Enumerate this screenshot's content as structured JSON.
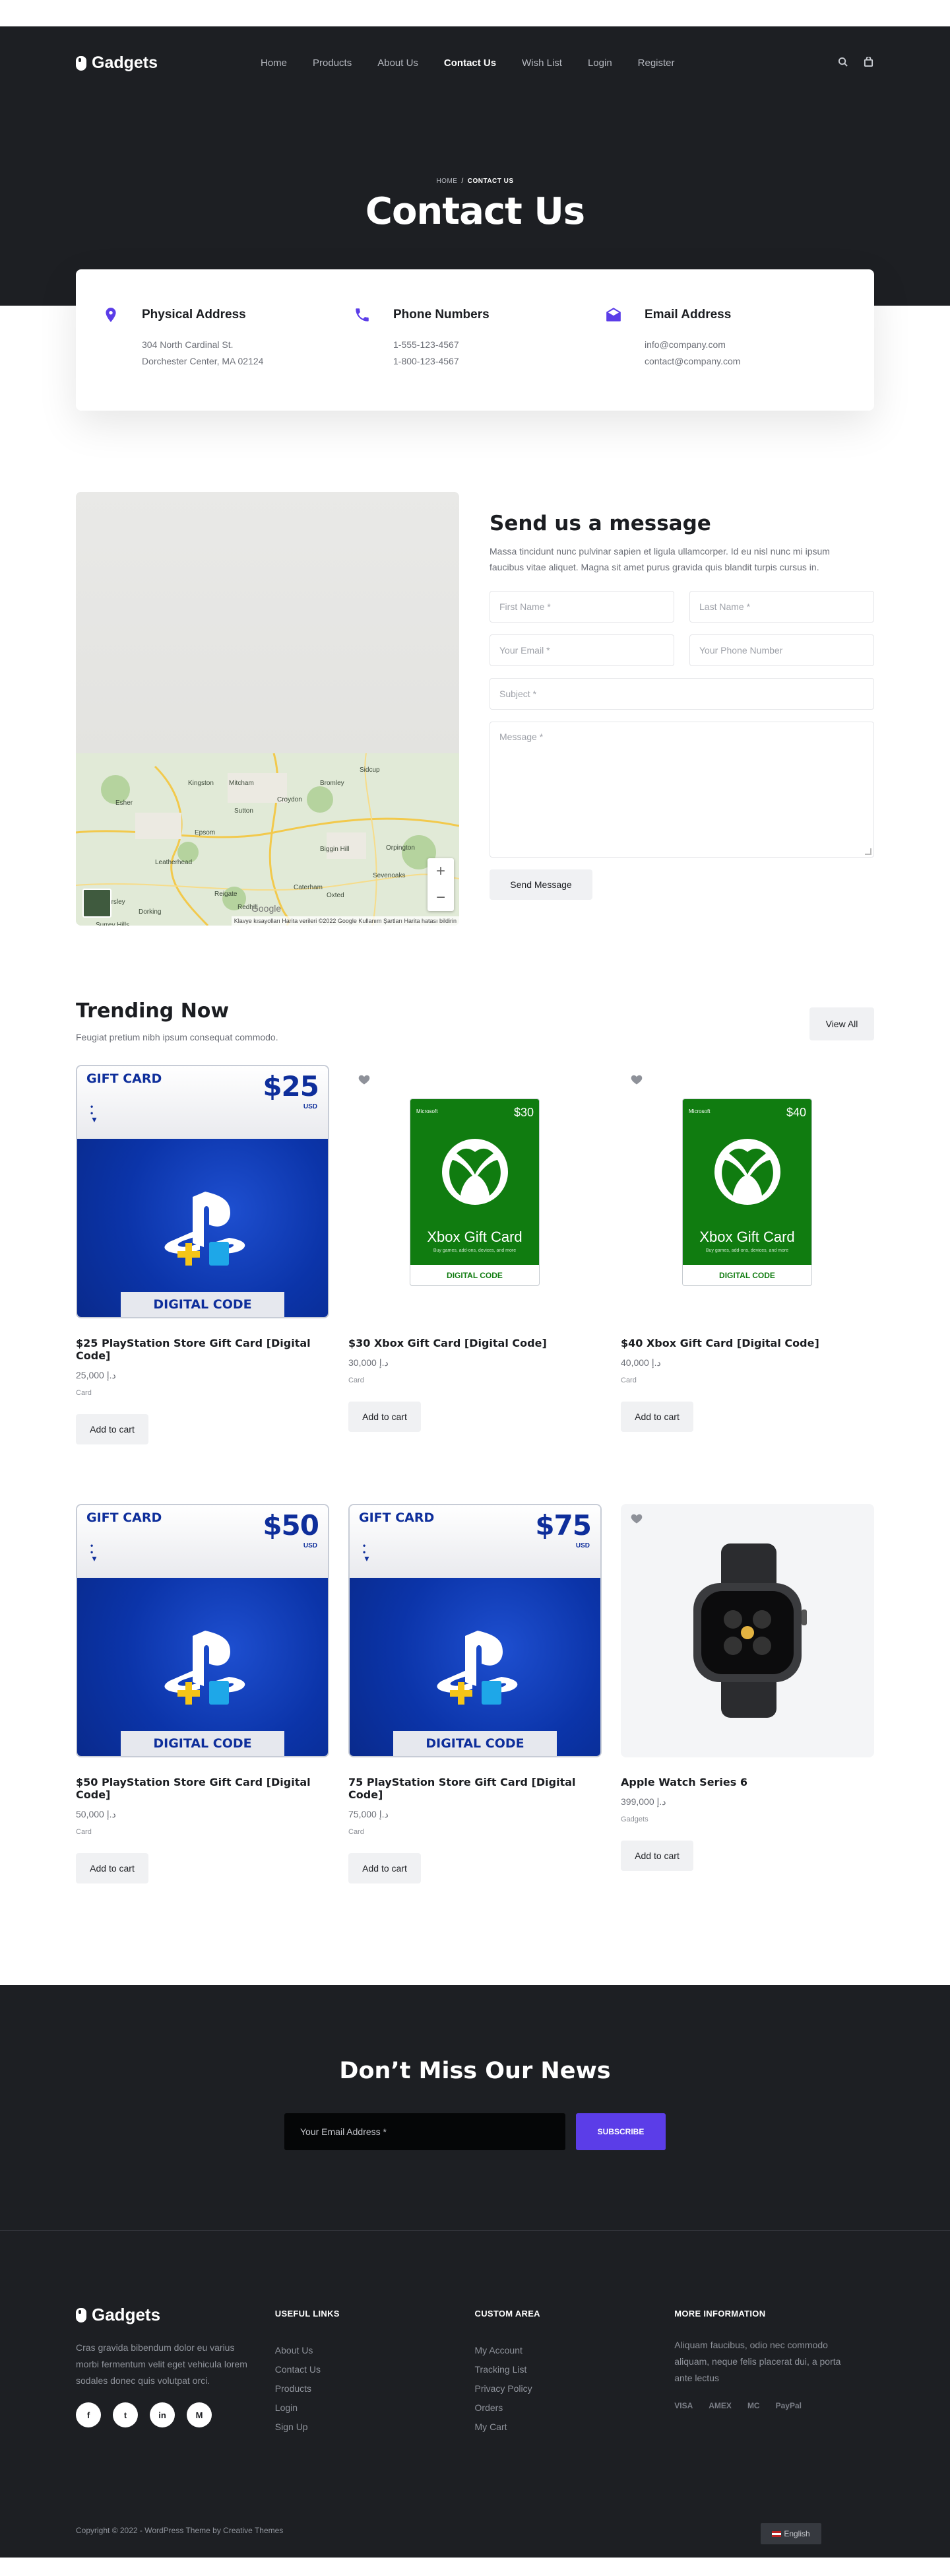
{
  "brand": {
    "name": "Gadgets"
  },
  "nav": {
    "items": [
      {
        "label": "Home"
      },
      {
        "label": "Products"
      },
      {
        "label": "About Us"
      },
      {
        "label": "Contact Us",
        "active": true
      },
      {
        "label": "Wish List"
      },
      {
        "label": "Login"
      },
      {
        "label": "Register"
      }
    ],
    "icons": [
      "search-icon",
      "bag-icon"
    ]
  },
  "hero": {
    "breadcrumb": {
      "home": "HOME",
      "separator": "/",
      "current": "CONTACT US"
    },
    "title": "Contact Us"
  },
  "contact": [
    {
      "icon": "map-pin-icon",
      "title": "Physical Address",
      "line1": "304 North Cardinal St.",
      "line2": "Dorchester Center, MA 02124"
    },
    {
      "icon": "phone-icon",
      "title": "Phone Numbers",
      "line1": "1-555-123-4567",
      "line2": "1-800-123-4567"
    },
    {
      "icon": "envelope-icon",
      "title": "Email Address",
      "line1": "info@company.com",
      "line2": "contact@company.com"
    }
  ],
  "map": {
    "attribution": "Klavye kısayolları   Harita verileri ©2022 Google   Kullanım Şartları   Harita hatası bildirin",
    "google": "Google",
    "zoom_in": "+",
    "zoom_out": "−",
    "places": [
      "Kingston",
      "Mitcham",
      "Croydon",
      "Bromley",
      "Sidcup",
      "Sutton",
      "Epsom",
      "Leatherhead",
      "Caterham",
      "Oxted",
      "Reigate",
      "Redhill",
      "Dorking",
      "Sevenoaks",
      "Biggin Hill",
      "Orpington",
      "Esher",
      "Surrey Hills",
      "East Horsley"
    ]
  },
  "message_form": {
    "title": "Send us a message",
    "lead": "Massa tincidunt nunc pulvinar sapien et ligula ullamcorper. Id eu nisl nunc mi ipsum faucibus vitae aliquet. Magna sit amet purus gravida quis blandit turpis cursus in.",
    "first_name": "First Name *",
    "last_name": "Last Name *",
    "email": "Your Email *",
    "phone": "Your Phone Number",
    "subject": "Subject *",
    "message": "Message *",
    "submit": "Send Message"
  },
  "trending": {
    "title": "Trending Now",
    "subtitle": "Feugiat pretium nibh ipsum consequat commodo.",
    "view_all": "View All",
    "add_to_cart": "Add to cart",
    "products": [
      {
        "name": "$25 PlayStation Store Gift Card [Digital Code]",
        "price": "د.إ 25,000",
        "category": "Card",
        "art": "ps",
        "amount": "$25",
        "wishlist": false
      },
      {
        "name": "$30 Xbox Gift Card [Digital Code]",
        "price": "د.إ 30,000",
        "category": "Card",
        "art": "xbox",
        "amount": "$30",
        "wishlist": true
      },
      {
        "name": "$40 Xbox Gift Card [Digital Code]",
        "price": "د.إ 40,000",
        "category": "Card",
        "art": "xbox",
        "amount": "$40",
        "wishlist": true
      },
      {
        "name": "$50 PlayStation Store Gift Card [Digital Code]",
        "price": "د.إ 50,000",
        "category": "Card",
        "art": "ps",
        "amount": "$50",
        "wishlist": false
      },
      {
        "name": "75 PlayStation Store Gift Card [Digital Code]",
        "price": "د.إ 75,000",
        "category": "Card",
        "art": "ps",
        "amount": "$75",
        "wishlist": false
      },
      {
        "name": "Apple Watch Series 6",
        "price": "د.إ 399,000",
        "category": "Gadgets",
        "art": "watch",
        "wishlist": true
      }
    ],
    "ps_art": {
      "gift": "GIFT CARD",
      "usd": "USD",
      "digital": "DIGITAL CODE"
    },
    "xbox_art": {
      "brand": "Microsoft",
      "title": "Xbox Gift Card",
      "sub": "Buy games, add-ons, devices, and more",
      "digital": "DIGITAL CODE"
    }
  },
  "newsletter": {
    "title": "Don’t Miss Our News",
    "placeholder": "Your Email Address *",
    "button": "SUBSCRIBE"
  },
  "footer": {
    "about": "Cras gravida bibendum dolor eu varius morbi fermentum velit eget vehicula lorem sodales donec quis volutpat orci.",
    "socials": [
      {
        "icon": "facebook-icon",
        "glyph": "f"
      },
      {
        "icon": "twitter-icon",
        "glyph": "t"
      },
      {
        "icon": "linkedin-icon",
        "glyph": "in"
      },
      {
        "icon": "medium-icon",
        "glyph": "M"
      }
    ],
    "useful_title": "USEFUL LINKS",
    "useful_links": [
      "About Us",
      "Contact Us",
      "Products",
      "Login",
      "Sign Up"
    ],
    "custom_title": "CUSTOM AREA",
    "custom_links": [
      "My Account",
      "Tracking List",
      "Privacy Policy",
      "Orders",
      "My Cart"
    ],
    "more_title": "MORE INFORMATION",
    "more_text": "Aliquam faucibus, odio nec commodo aliquam, neque felis placerat dui, a porta ante lectus",
    "payments": [
      "VISA",
      "AMEX",
      "MC",
      "PayPal"
    ],
    "copyright": "Copyright © 2022 - WordPress Theme by Creative Themes",
    "language": "English"
  },
  "colors": {
    "accent": "#5b3de8",
    "dark": "#1d1f23",
    "xbox_green": "#107c10",
    "ps_blue": "#0b34a9"
  }
}
